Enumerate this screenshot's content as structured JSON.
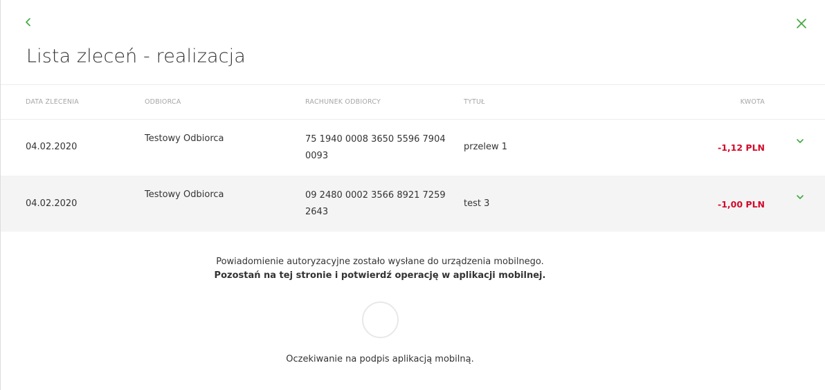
{
  "header": {
    "title": "Lista zleceń - realizacja",
    "back_icon": "chevron-left-icon",
    "close_icon": "close-icon",
    "accent_color": "#3ea83a"
  },
  "table": {
    "columns": {
      "date": "DATA ZLECENIA",
      "recipient": "ODBIORCA",
      "account": "RACHUNEK ODBIORCY",
      "title": "TYTUŁ",
      "amount": "KWOTA"
    },
    "rows": [
      {
        "date": "04.02.2020",
        "recipient": "Testowy Odbiorca",
        "account": "75 1940 0008 3650 5596 7904 0093",
        "title": "przelew 1",
        "amount": "-1,12 PLN"
      },
      {
        "date": "04.02.2020",
        "recipient": "Testowy Odbiorca",
        "account": "09 2480 0002 3566 8921 7259 2643",
        "title": "test 3",
        "amount": "-1,00 PLN"
      }
    ],
    "amount_color": "#d20a2a",
    "expand_icon": "chevron-down-icon"
  },
  "notice": {
    "line1": "Powiadomienie autoryzacyjne zostało wysłane do urządzenia mobilnego.",
    "line2": "Pozostań na tej stronie i potwierdź operację w aplikacji mobilnej."
  },
  "status": {
    "waiting": "Oczekiwanie na podpis aplikacją mobilną."
  }
}
